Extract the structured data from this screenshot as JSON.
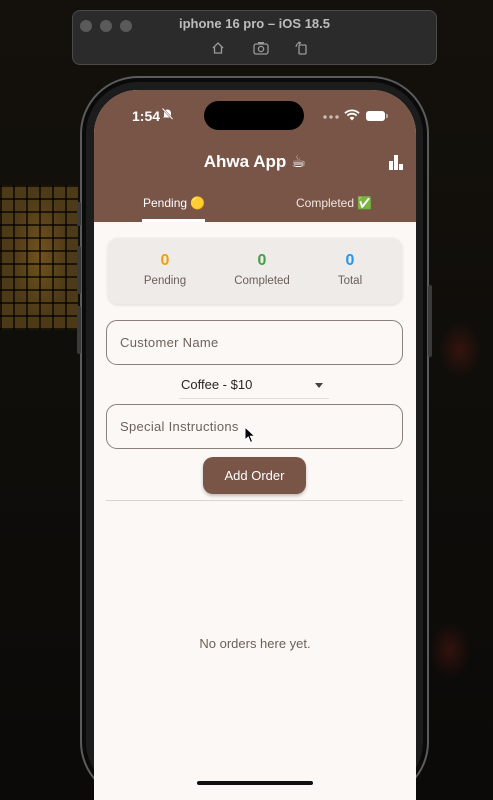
{
  "simulator": {
    "title": "iphone 16 pro – iOS 18.5",
    "toolbar_icons": [
      "home-icon",
      "screenshot-icon",
      "rotate-icon"
    ]
  },
  "status_bar": {
    "time": "1:54"
  },
  "app": {
    "title": "Ahwa App ☕",
    "header_color": "#795548",
    "tabs": [
      {
        "label": "Pending 🟡",
        "active": true
      },
      {
        "label": "Completed ✅",
        "active": false
      }
    ]
  },
  "stats": [
    {
      "value": "0",
      "label": "Pending",
      "color": "#f59e0b"
    },
    {
      "value": "0",
      "label": "Completed",
      "color": "#43a047"
    },
    {
      "value": "0",
      "label": "Total",
      "color": "#2196f3"
    }
  ],
  "form": {
    "customer_name_label": "Customer Name",
    "drink_selected": "Coffee - $10",
    "instructions_label": "Special Instructions",
    "add_button_label": "Add Order"
  },
  "orders": {
    "empty_message": "No orders here yet."
  }
}
